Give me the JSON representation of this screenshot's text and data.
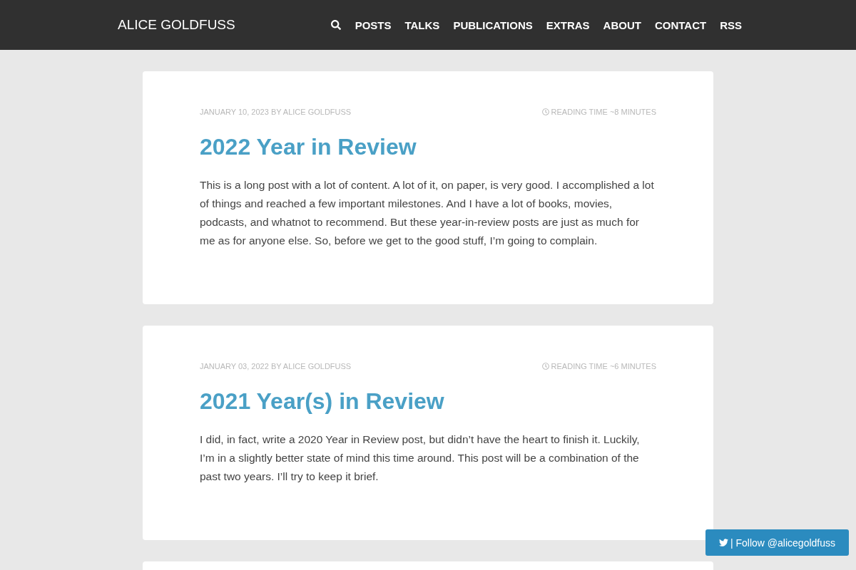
{
  "header": {
    "site_title": "ALICE GOLDFUSS",
    "nav": [
      "POSTS",
      "TALKS",
      "PUBLICATIONS",
      "EXTRAS",
      "ABOUT",
      "CONTACT",
      "RSS"
    ]
  },
  "posts": [
    {
      "date_line": "JANUARY 10, 2023 BY ALICE GOLDFUSS",
      "reading_time": "READING TIME ~8 MINUTES",
      "title": "2022 Year in Review",
      "excerpt": "This is a long post with a lot of content. A lot of it, on paper, is very good. I accomplished a lot of things and reached a few important milestones. And I have a lot of books, movies, podcasts, and whatnot to recommend. But these year-in-review posts are just as much for me as for anyone else. So, before we get to the good stuff, I’m going to complain."
    },
    {
      "date_line": "JANUARY 03, 2022 BY ALICE GOLDFUSS",
      "reading_time": "READING TIME ~6 MINUTES",
      "title": "2021 Year(s) in Review",
      "excerpt": "I did, in fact, write a 2020 Year in Review post, but didn’t have the heart to finish it. Luckily, I’m in a slightly better state of mind this time around. This post will be a combination of the past two years. I’ll try to keep it brief."
    }
  ],
  "follow_button": {
    "label": "| Follow @alicegoldfuss"
  }
}
